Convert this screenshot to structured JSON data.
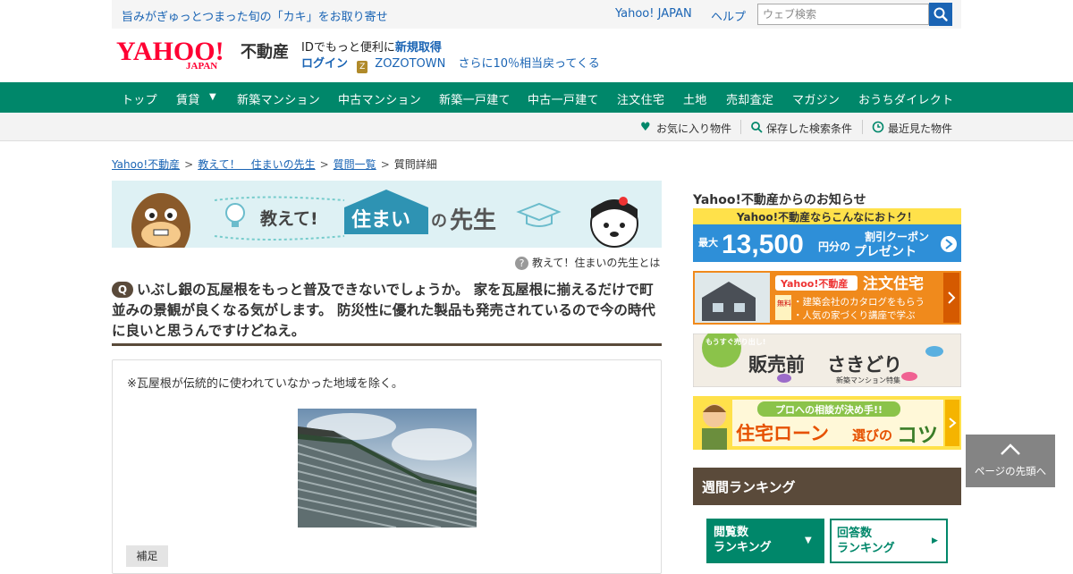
{
  "top": {
    "promo": "旨みがぎゅっとつまった旬の「カキ」をお取り寄せ",
    "yahoo_japan": "Yahoo! JAPAN",
    "help": "ヘルプ",
    "search_placeholder": "ウェブ検索"
  },
  "header": {
    "logo_text": "YAHOO!",
    "logo_sub": "JAPAN",
    "service_name": "不動産",
    "id_text": "IDでもっと便利に",
    "id_link": "新規取得",
    "login": "ログイン",
    "zozo": "ZOZOTOWN",
    "zozo_note": "さらに10％相当戻ってくる"
  },
  "nav": {
    "items": [
      "トップ",
      "賃貸",
      "新築マンション",
      "中古マンション",
      "新築一戸建て",
      "中古一戸建て",
      "注文住宅",
      "土地",
      "売却査定",
      "マガジン",
      "おうちダイレクト"
    ]
  },
  "subbar": {
    "favorites": "お気に入り物件",
    "saved_search": "保存した検索条件",
    "recent": "最近見た物件"
  },
  "breadcrumb": [
    "Yahoo!不動産",
    "教えて！　住まいの先生",
    "質問一覧",
    "質問詳細"
  ],
  "banner": {
    "teach": "教えて!",
    "sumai": "住まい",
    "no": "の",
    "sensei": "先生"
  },
  "about_link": "教えて！住まいの先生とは",
  "question": {
    "badge": "Q",
    "text": "いぶし銀の瓦屋根をもっと普及できないでしょうか。 家を瓦屋根に揃えるだけで町並みの景観が良くなる気がします。 防災性に優れた製品も発売されているので今の時代に良いと思うんですけどねえ。"
  },
  "detail": {
    "note": "※瓦屋根が伝統的に使われていなかった地域を除く。",
    "supplement": "補足"
  },
  "sidebar": {
    "news_title": "Yahoo!不動産からのお知らせ",
    "banner1": {
      "top": "Yahoo!不動産ならこんなにおトク！",
      "max": "最大",
      "amount": "13,500",
      "unit": "円分の",
      "coupon": "割引クーポン",
      "present": "プレゼント"
    },
    "banner2": {
      "brand": "Yahoo!不動産",
      "title": "注文住宅",
      "free": "無料",
      "line1": "・建築会社のカタログをもらう",
      "line2": "・人気の家づくり講座で学ぶ"
    },
    "banner3": {
      "badge": "もうすぐ売り出し!",
      "title": "販売前",
      "title2": "さきどり",
      "sub": "新築マンション特集"
    },
    "banner4": {
      "top": "プロへの相談が決め手!!",
      "main1": "住宅ローン",
      "main2": "選びの",
      "main3": "コツ"
    },
    "ranking_title": "週間ランキング",
    "rank_views": "閲覧数ランキング",
    "rank_views_l1": "閲覧数",
    "rank_views_l2": "ランキング",
    "rank_answers_l1": "回答数",
    "rank_answers_l2": "ランキング"
  },
  "to_top": "ページの先頭へ",
  "colors": {
    "nav": "#00876a",
    "link": "#1a64b4",
    "brown": "#5a4a3a",
    "logo_red": "#ff0033"
  }
}
